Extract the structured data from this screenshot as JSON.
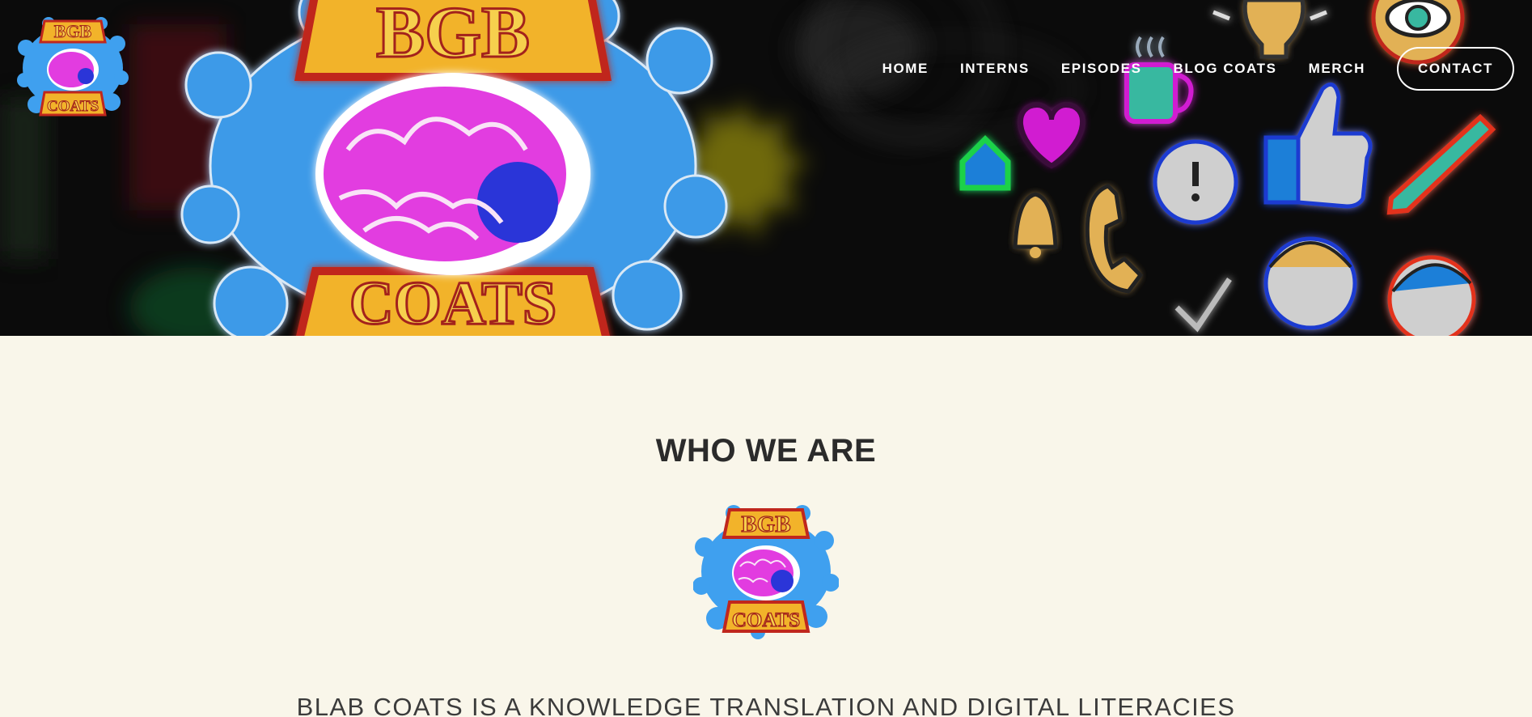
{
  "nav": {
    "items": [
      {
        "label": "HOME"
      },
      {
        "label": "INTERNS"
      },
      {
        "label": "EPISODES"
      },
      {
        "label": "BLOG COATS"
      },
      {
        "label": "MERCH"
      }
    ],
    "cta_label": "CONTACT"
  },
  "hero": {
    "icons": [
      "home-icon",
      "heart-icon",
      "coffee-icon",
      "lightbulb-icon",
      "eye-icon",
      "thumbs-up-icon",
      "pencil-icon",
      "bell-icon",
      "phone-icon",
      "speech-bubble-icon",
      "checkmark-icon",
      "person-icon"
    ]
  },
  "colors": {
    "page_background": "#f9f6ea",
    "hero_background": "#0a0a0a",
    "heading": "#2b2b2b",
    "logo_blue": "#3fa0ef",
    "logo_gold": "#f2b32a",
    "logo_red": "#c0271d",
    "logo_pink": "#e23ce0"
  },
  "main": {
    "title": "WHO WE ARE",
    "intro": "BLAB COATS IS A KNOWLEDGE TRANSLATION AND DIGITAL LITERACIES"
  }
}
